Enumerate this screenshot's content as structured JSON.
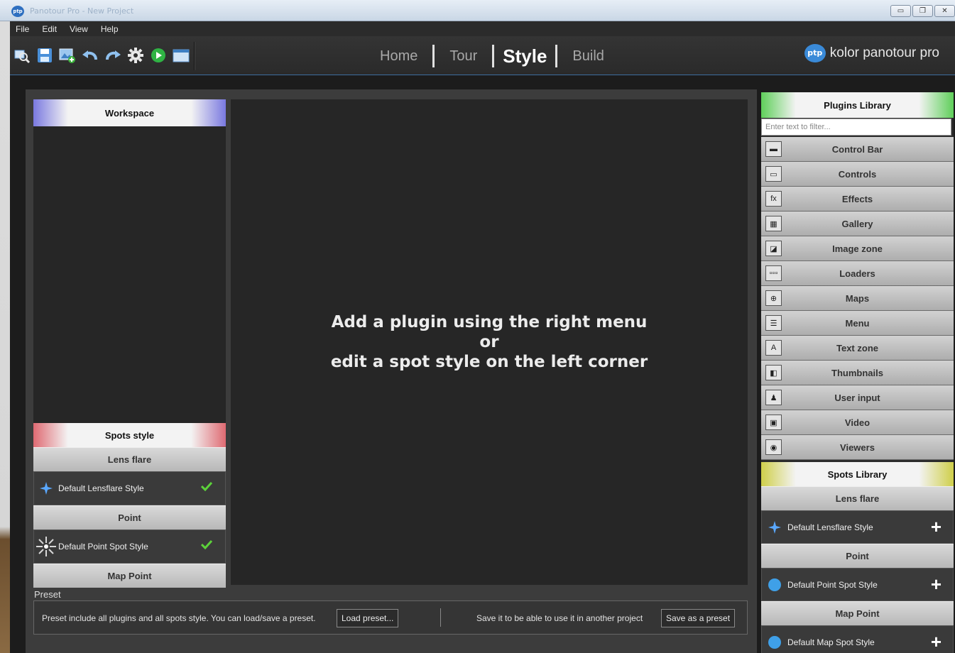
{
  "window": {
    "icon": "ptp",
    "title": "Panotour Pro - New Project",
    "controls": [
      "▭",
      "❐",
      "✕"
    ]
  },
  "menubar": [
    "File",
    "Edit",
    "View",
    "Help"
  ],
  "toolbar": {
    "icons": [
      "search-images-icon",
      "save-icon",
      "add-image-icon",
      "undo-icon",
      "redo-icon",
      "settings-gear-icon",
      "play-icon",
      "preview-window-icon"
    ]
  },
  "nav": {
    "home": "Home",
    "tour": "Tour",
    "style": "Style",
    "build": "Build",
    "active": "Style"
  },
  "brand": {
    "logo": "ptp",
    "name": "kolor panotour pro"
  },
  "workspace": {
    "title": "Workspace",
    "spots_style_title": "Spots style",
    "categories": {
      "lens_flare": "Lens flare",
      "point": "Point",
      "map_point": "Map Point"
    },
    "items": {
      "lensflare": "Default Lensflare Style",
      "point": "Default Point Spot Style"
    }
  },
  "canvas": {
    "line1": "Add a plugin using the right menu",
    "line2": "or",
    "line3": "edit a spot style on the left corner"
  },
  "preset": {
    "label": "Preset",
    "description": "Preset include all plugins and all spots style. You can load/save a preset.",
    "load_button": "Load preset...",
    "save_hint": "Save it to be able to use it in another project",
    "save_button": "Save as a preset"
  },
  "plugins_library": {
    "title": "Plugins Library",
    "filter_placeholder": "Enter text to filter...",
    "items": [
      {
        "label": "Control Bar",
        "icon": "control-bar-icon",
        "glyph": "▬"
      },
      {
        "label": "Controls",
        "icon": "controls-icon",
        "glyph": "▭"
      },
      {
        "label": "Effects",
        "icon": "effects-fx-icon",
        "glyph": "fx"
      },
      {
        "label": "Gallery",
        "icon": "gallery-icon",
        "glyph": "▦"
      },
      {
        "label": "Image zone",
        "icon": "image-zone-icon",
        "glyph": "◪"
      },
      {
        "label": "Loaders",
        "icon": "loaders-icon",
        "glyph": "▫▫▫"
      },
      {
        "label": "Maps",
        "icon": "maps-globe-icon",
        "glyph": "⊕"
      },
      {
        "label": "Menu",
        "icon": "menu-icon",
        "glyph": "☰"
      },
      {
        "label": "Text zone",
        "icon": "text-zone-icon",
        "glyph": "A"
      },
      {
        "label": "Thumbnails",
        "icon": "thumbnails-icon",
        "glyph": "◧"
      },
      {
        "label": "User input",
        "icon": "user-input-icon",
        "glyph": "♟"
      },
      {
        "label": "Video",
        "icon": "video-icon",
        "glyph": "▣"
      },
      {
        "label": "Viewers",
        "icon": "viewers-eye-icon",
        "glyph": "◉"
      }
    ]
  },
  "spots_library": {
    "title": "Spots Library",
    "categories": {
      "lens_flare": "Lens flare",
      "point": "Point",
      "map_point": "Map Point"
    },
    "items": {
      "lensflare": "Default Lensflare Style",
      "point": "Default Point Spot Style",
      "map": "Default Map Spot Style"
    },
    "add_glyph": "+"
  },
  "colors": {
    "accent_blue": "#7a79e0",
    "accent_red": "#df6a72",
    "accent_green": "#5fcf5a",
    "accent_yellow": "#cfcf4a",
    "check_green": "#5cd23a",
    "star_blue": "#5aa8ff"
  }
}
